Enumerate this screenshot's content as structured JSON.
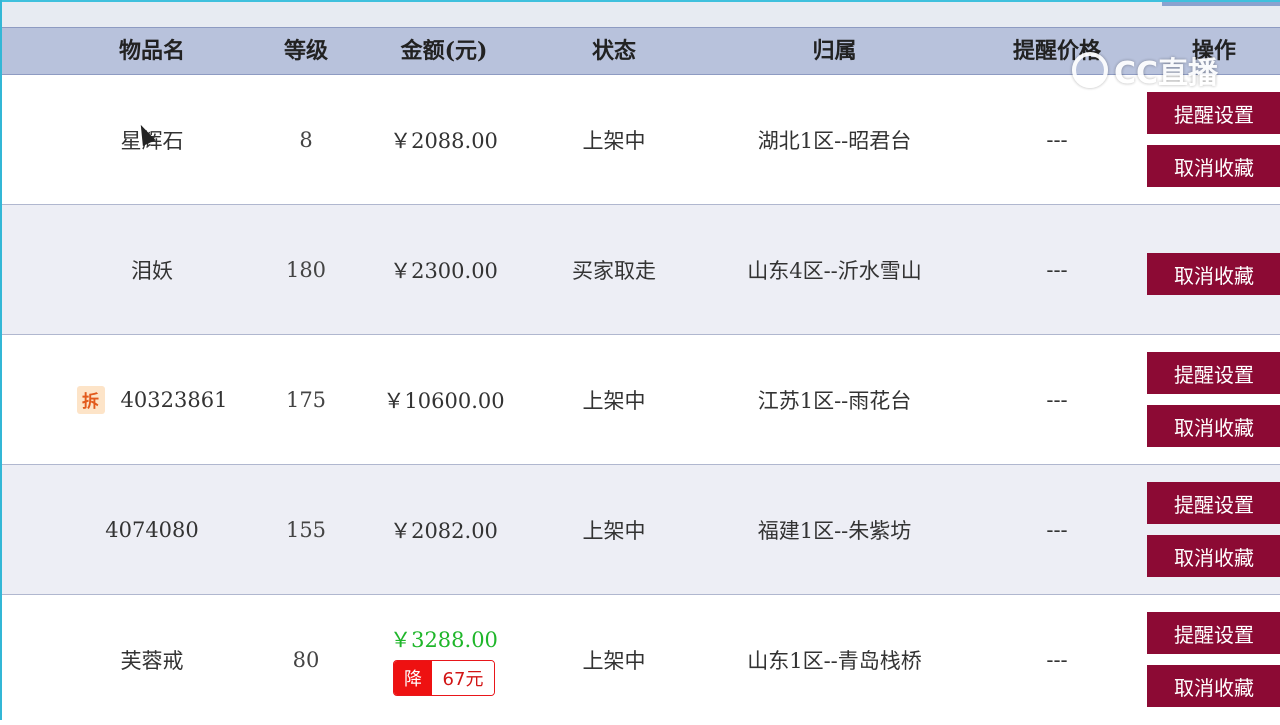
{
  "header": {
    "name": "物品名",
    "level": "等级",
    "price": "金额(元)",
    "status": "状态",
    "owner": "归属",
    "alert_price": "提醒价格",
    "ops": "操作"
  },
  "buttons": {
    "alert_settings": "提醒设置",
    "unfavorite": "取消收藏"
  },
  "rows": [
    {
      "name": "星辉石",
      "level": "8",
      "price": "￥2088.00",
      "status": "上架中",
      "owner": "湖北1区--昭君台",
      "alert": "---"
    },
    {
      "name": "泪妖",
      "level": "180",
      "price": "￥2300.00",
      "status": "买家取走",
      "owner": "山东4区--沂水雪山",
      "alert": "---"
    },
    {
      "name": "40323861",
      "tag": "拆",
      "level": "175",
      "price": "￥10600.00",
      "status": "上架中",
      "owner": "江苏1区--雨花台",
      "alert": "---"
    },
    {
      "name": "4074080",
      "level": "155",
      "price": "￥2082.00",
      "status": "上架中",
      "owner": "福建1区--朱紫坊",
      "alert": "---"
    },
    {
      "name": "芙蓉戒",
      "level": "80",
      "price": "￥3288.00",
      "drop_label": "降",
      "drop_amount": "67元",
      "status": "上架中",
      "owner": "山东1区--青岛栈桥",
      "alert": "---"
    }
  ],
  "watermark": "CC直播",
  "colors": {
    "header_bg": "#b8c2dc",
    "price_normal": "#1fb62a",
    "price_high": "#e8161a",
    "button_bg": "#8c0a34"
  }
}
